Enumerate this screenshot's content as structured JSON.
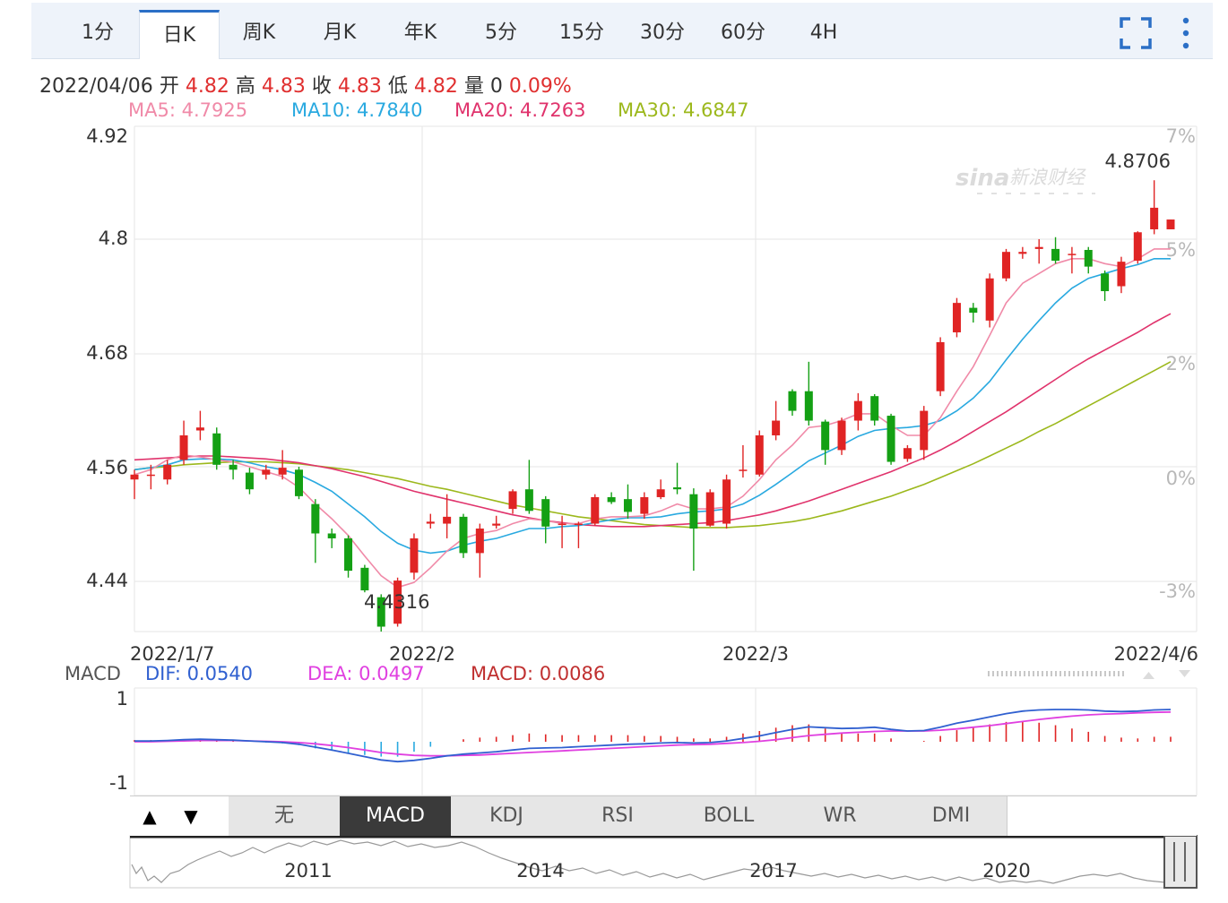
{
  "tabs": [
    {
      "label": "1分",
      "active": false
    },
    {
      "label": "日K",
      "active": true
    },
    {
      "label": "周K",
      "active": false
    },
    {
      "label": "月K",
      "active": false
    },
    {
      "label": "年K",
      "active": false
    },
    {
      "label": "5分",
      "active": false
    },
    {
      "label": "15分",
      "active": false
    },
    {
      "label": "30分",
      "active": false
    },
    {
      "label": "60分",
      "active": false
    },
    {
      "label": "4H",
      "active": false
    }
  ],
  "quote": {
    "date": "2022/04/06",
    "open_label": "开",
    "open": "4.82",
    "high_label": "高",
    "high": "4.83",
    "close_label": "收",
    "close": "4.83",
    "low_label": "低",
    "low": "4.82",
    "vol_label": "量",
    "vol": "0",
    "change": "0.09%"
  },
  "ma": {
    "ma5": "MA5: 4.7925",
    "ma10": "MA10: 4.7840",
    "ma20": "MA20: 4.7263",
    "ma30": "MA30: 4.6847"
  },
  "macd_labels": {
    "name": "MACD",
    "dif": "DIF: 0.0540",
    "dea": "DEA: 0.0497",
    "macd": "MACD: 0.0086"
  },
  "indicator_buttons": [
    "无",
    "MACD",
    "KDJ",
    "RSI",
    "BOLL",
    "WR",
    "DMI"
  ],
  "active_indicator": "MACD",
  "nav_arrows": {
    "up": "▲",
    "down": "▼"
  },
  "overview_years": [
    "2011",
    "2014",
    "2017",
    "2020"
  ],
  "colors": {
    "up": "#e02424",
    "down": "#14a014",
    "ma5": "#f08aa8",
    "ma10": "#29a9e0",
    "ma20": "#e0336c",
    "ma30": "#9cb81c",
    "dif": "#3060d0",
    "dea": "#e040e0",
    "accent": "#2b6fc6"
  },
  "chart_data": {
    "type": "candlestick",
    "y_ticks": [
      "4.92",
      "4.8",
      "4.68",
      "4.56",
      "4.44"
    ],
    "pct_ticks": [
      "7%",
      "5%",
      "2%",
      "0%",
      "-3%"
    ],
    "ylim": [
      4.41,
      4.925
    ],
    "x_labels": [
      "2022/1/7",
      "2022/2",
      "2022/3",
      "2022/4/6"
    ],
    "annotations": {
      "high": "4.8706",
      "low": "4.4316"
    },
    "macd_y_ticks": [
      "1",
      "-1"
    ],
    "candles": [
      [
        4.565,
        4.57,
        4.575,
        4.545
      ],
      [
        4.57,
        4.57,
        4.58,
        4.555
      ],
      [
        4.565,
        4.58,
        4.585,
        4.56
      ],
      [
        4.585,
        4.61,
        4.625,
        4.58
      ],
      [
        4.615,
        4.618,
        4.635,
        4.605
      ],
      [
        4.612,
        4.58,
        4.618,
        4.575
      ],
      [
        4.58,
        4.575,
        4.585,
        4.565
      ],
      [
        4.572,
        4.555,
        4.577,
        4.55
      ],
      [
        4.57,
        4.575,
        4.58,
        4.565
      ],
      [
        4.57,
        4.577,
        4.595,
        4.565
      ],
      [
        4.575,
        4.548,
        4.578,
        4.545
      ],
      [
        4.54,
        4.51,
        4.545,
        4.48
      ],
      [
        4.51,
        4.505,
        4.515,
        4.495
      ],
      [
        4.505,
        4.472,
        4.508,
        4.465
      ],
      [
        4.475,
        4.452,
        4.478,
        4.45
      ],
      [
        4.445,
        4.415,
        4.448,
        4.41
      ],
      [
        4.418,
        4.462,
        4.465,
        4.415
      ],
      [
        4.47,
        4.505,
        4.51,
        4.463
      ],
      [
        4.52,
        4.522,
        4.53,
        4.515
      ],
      [
        4.52,
        4.527,
        4.55,
        4.505
      ],
      [
        4.527,
        4.49,
        4.53,
        4.485
      ],
      [
        4.49,
        4.515,
        4.52,
        4.465
      ],
      [
        4.518,
        4.52,
        4.528,
        4.515
      ],
      [
        4.535,
        4.553,
        4.555,
        4.53
      ],
      [
        4.555,
        4.533,
        4.585,
        4.53
      ],
      [
        4.545,
        4.517,
        4.548,
        4.5
      ],
      [
        4.52,
        4.52,
        4.528,
        4.495
      ],
      [
        4.519,
        4.52,
        4.522,
        4.495
      ],
      [
        4.52,
        4.547,
        4.55,
        4.518
      ],
      [
        4.547,
        4.542,
        4.552,
        4.54
      ],
      [
        4.545,
        4.532,
        4.56,
        4.525
      ],
      [
        4.53,
        4.547,
        4.552,
        4.525
      ],
      [
        4.547,
        4.555,
        4.565,
        4.545
      ],
      [
        4.557,
        4.555,
        4.582,
        4.55
      ],
      [
        4.55,
        4.515,
        4.556,
        4.472
      ],
      [
        4.518,
        4.552,
        4.555,
        4.517
      ],
      [
        4.52,
        4.565,
        4.57,
        4.515
      ],
      [
        4.575,
        4.575,
        4.6,
        4.567
      ],
      [
        4.57,
        4.61,
        4.615,
        4.568
      ],
      [
        4.61,
        4.625,
        4.645,
        4.605
      ],
      [
        4.655,
        4.635,
        4.657,
        4.63
      ],
      [
        4.655,
        4.625,
        4.685,
        4.62
      ],
      [
        4.624,
        4.595,
        4.626,
        4.58
      ],
      [
        4.595,
        4.625,
        4.628,
        4.59
      ],
      [
        4.625,
        4.645,
        4.653,
        4.615
      ],
      [
        4.65,
        4.625,
        4.652,
        4.62
      ],
      [
        4.63,
        4.583,
        4.632,
        4.58
      ],
      [
        4.586,
        4.597,
        4.6,
        4.583
      ],
      [
        4.595,
        4.635,
        4.64,
        4.585
      ],
      [
        4.655,
        4.705,
        4.71,
        4.65
      ],
      [
        4.715,
        4.745,
        4.75,
        4.71
      ],
      [
        4.74,
        4.735,
        4.745,
        4.725
      ],
      [
        4.727,
        4.77,
        4.775,
        4.72
      ],
      [
        4.77,
        4.797,
        4.8,
        4.767
      ],
      [
        4.795,
        4.797,
        4.802,
        4.79
      ],
      [
        4.8,
        4.802,
        4.81,
        4.785
      ],
      [
        4.8,
        4.788,
        4.812,
        4.785
      ],
      [
        4.795,
        4.795,
        4.802,
        4.775
      ],
      [
        4.799,
        4.782,
        4.802,
        4.775
      ],
      [
        4.775,
        4.757,
        4.778,
        4.747
      ],
      [
        4.762,
        4.787,
        4.792,
        4.755
      ],
      [
        4.788,
        4.817,
        4.818,
        4.785
      ],
      [
        4.82,
        4.842,
        4.87,
        4.815
      ],
      [
        4.82,
        4.83,
        4.83,
        4.82
      ]
    ],
    "ma5": [
      4.57,
      4.575,
      4.585,
      4.59,
      4.588,
      4.585,
      4.583,
      4.578,
      4.573,
      4.568,
      4.557,
      4.54,
      4.525,
      4.508,
      4.487,
      4.467,
      4.455,
      4.46,
      4.475,
      4.492,
      4.505,
      4.51,
      4.513,
      4.52,
      4.525,
      4.523,
      4.52,
      4.52,
      4.525,
      4.527,
      4.527,
      4.528,
      4.533,
      4.54,
      4.535,
      4.535,
      4.537,
      4.548,
      4.565,
      4.585,
      4.6,
      4.618,
      4.62,
      4.625,
      4.632,
      4.632,
      4.62,
      4.61,
      4.61,
      4.628,
      4.655,
      4.68,
      4.712,
      4.745,
      4.765,
      4.775,
      4.785,
      4.79,
      4.79,
      4.785,
      4.782,
      4.79,
      4.8,
      4.8
    ],
    "ma10": [
      4.575,
      4.577,
      4.58,
      4.585,
      4.586,
      4.586,
      4.585,
      4.582,
      4.578,
      4.575,
      4.57,
      4.562,
      4.553,
      4.54,
      4.527,
      4.512,
      4.5,
      4.493,
      4.49,
      4.492,
      4.498,
      4.502,
      4.505,
      4.51,
      4.515,
      4.515,
      4.517,
      4.518,
      4.521,
      4.524,
      4.526,
      4.526,
      4.527,
      4.53,
      4.532,
      4.533,
      4.535,
      4.54,
      4.549,
      4.56,
      4.572,
      4.584,
      4.592,
      4.6,
      4.609,
      4.615,
      4.617,
      4.618,
      4.62,
      4.625,
      4.635,
      4.648,
      4.665,
      4.687,
      4.708,
      4.727,
      4.745,
      4.76,
      4.77,
      4.775,
      4.78,
      4.784,
      4.79,
      4.79
    ],
    "ma20": [
      4.585,
      4.586,
      4.587,
      4.588,
      4.589,
      4.589,
      4.588,
      4.587,
      4.586,
      4.584,
      4.582,
      4.579,
      4.576,
      4.572,
      4.568,
      4.563,
      4.558,
      4.553,
      4.549,
      4.545,
      4.541,
      4.537,
      4.533,
      4.529,
      4.526,
      4.523,
      4.521,
      4.519,
      4.518,
      4.517,
      4.517,
      4.517,
      4.518,
      4.519,
      4.52,
      4.521,
      4.523,
      4.526,
      4.529,
      4.533,
      4.538,
      4.543,
      4.549,
      4.555,
      4.561,
      4.567,
      4.573,
      4.58,
      4.587,
      4.595,
      4.604,
      4.614,
      4.624,
      4.634,
      4.645,
      4.656,
      4.667,
      4.678,
      4.688,
      4.697,
      4.706,
      4.715,
      4.725,
      4.734
    ],
    "ma30": [
      4.575,
      4.577,
      4.578,
      4.58,
      4.581,
      4.582,
      4.583,
      4.583,
      4.583,
      4.582,
      4.581,
      4.579,
      4.577,
      4.575,
      4.572,
      4.569,
      4.566,
      4.562,
      4.558,
      4.555,
      4.551,
      4.547,
      4.543,
      4.539,
      4.536,
      4.533,
      4.53,
      4.527,
      4.525,
      4.523,
      4.521,
      4.519,
      4.518,
      4.517,
      4.516,
      4.516,
      4.516,
      4.517,
      4.518,
      4.52,
      4.522,
      4.525,
      4.529,
      4.533,
      4.538,
      4.543,
      4.548,
      4.554,
      4.56,
      4.567,
      4.574,
      4.581,
      4.589,
      4.597,
      4.605,
      4.614,
      4.622,
      4.631,
      4.64,
      4.649,
      4.658,
      4.667,
      4.676,
      4.685
    ],
    "macd": {
      "ylim": [
        -1.3,
        1.3
      ],
      "dif": [
        0.02,
        0.02,
        0.03,
        0.05,
        0.06,
        0.05,
        0.04,
        0.02,
        0.0,
        -0.02,
        -0.06,
        -0.13,
        -0.2,
        -0.28,
        -0.36,
        -0.44,
        -0.48,
        -0.45,
        -0.4,
        -0.34,
        -0.3,
        -0.27,
        -0.24,
        -0.2,
        -0.16,
        -0.15,
        -0.14,
        -0.12,
        -0.1,
        -0.08,
        -0.06,
        -0.05,
        -0.03,
        -0.02,
        -0.03,
        -0.02,
        0.02,
        0.08,
        0.14,
        0.22,
        0.3,
        0.36,
        0.34,
        0.32,
        0.33,
        0.35,
        0.3,
        0.26,
        0.27,
        0.35,
        0.45,
        0.52,
        0.6,
        0.68,
        0.74,
        0.77,
        0.78,
        0.78,
        0.77,
        0.74,
        0.73,
        0.74,
        0.77,
        0.78
      ],
      "dea": [
        0.0,
        0.0,
        0.01,
        0.02,
        0.03,
        0.03,
        0.03,
        0.02,
        0.01,
        0.0,
        -0.02,
        -0.05,
        -0.09,
        -0.14,
        -0.2,
        -0.26,
        -0.3,
        -0.33,
        -0.34,
        -0.34,
        -0.33,
        -0.32,
        -0.3,
        -0.28,
        -0.26,
        -0.24,
        -0.22,
        -0.2,
        -0.18,
        -0.16,
        -0.14,
        -0.12,
        -0.1,
        -0.08,
        -0.07,
        -0.06,
        -0.04,
        -0.02,
        0.01,
        0.05,
        0.1,
        0.15,
        0.18,
        0.21,
        0.23,
        0.25,
        0.26,
        0.26,
        0.26,
        0.28,
        0.31,
        0.35,
        0.39,
        0.44,
        0.49,
        0.54,
        0.58,
        0.62,
        0.65,
        0.67,
        0.68,
        0.7,
        0.71,
        0.72
      ]
    }
  }
}
